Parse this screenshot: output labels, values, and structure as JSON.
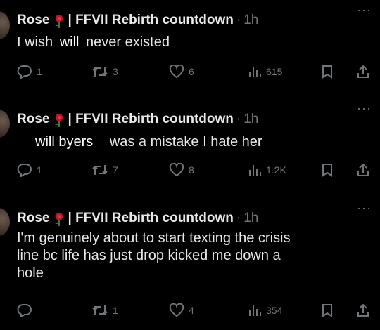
{
  "tweets": [
    {
      "author": "Rose",
      "handle_text": "| FFVII Rebirth countdown",
      "separator": "·",
      "time": "1h",
      "body_lines": [
        "I wish"
      ],
      "overlay_text": "will",
      "body_tail": "never existed",
      "replies": "1",
      "retweets": "3",
      "likes": "6",
      "views": "615"
    },
    {
      "author": "Rose",
      "handle_text": "| FFVII Rebirth countdown",
      "separator": "·",
      "time": "1h",
      "overlay_text": "will byers",
      "body_tail": "was a mistake I hate her",
      "replies": "1",
      "retweets": "7",
      "likes": "8",
      "views": "1.2K"
    },
    {
      "author": "Rose",
      "handle_text": "| FFVII Rebirth countdown",
      "separator": "·",
      "time": "1h",
      "body_lines": [
        "I'm genuinely about to start texting the crisis",
        "line bc life has just drop kicked me down a",
        "hole"
      ],
      "replies": "",
      "retweets": "1",
      "likes": "4",
      "views": "354"
    }
  ],
  "icons": {
    "reply": "reply-icon",
    "retweet": "retweet-icon",
    "like": "heart-icon",
    "views": "views-icon",
    "bookmark": "bookmark-icon",
    "share": "share-icon",
    "more": "more-icon",
    "rose": "rose-emoji-icon"
  },
  "more_label": "···",
  "colors": {
    "background": "#000000",
    "text": "#e7e9ea",
    "muted": "#71767b"
  }
}
